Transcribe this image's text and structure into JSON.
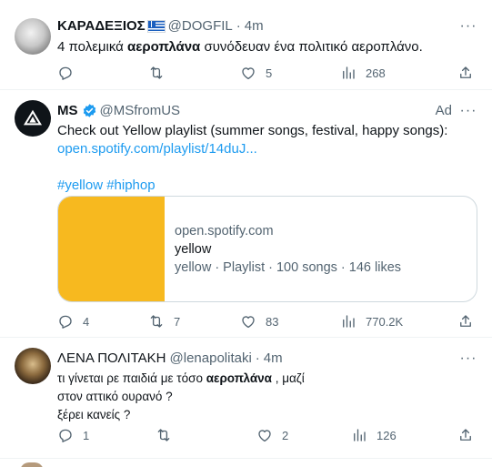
{
  "tweets": [
    {
      "name": "ΚΑΡΑΔΕΞΙΟΣ",
      "handle": "@DOGFIL",
      "sep": "·",
      "time": "4m",
      "text_before": "4 πολεμικά ",
      "text_bold": "αεροπλάνα",
      "text_after": " συνόδευαν ένα πολιτικό αεροπλάνο.",
      "replies": "",
      "retweets": "",
      "likes": "5",
      "views": "268"
    },
    {
      "name": "MS",
      "handle": "@MSfromUS",
      "ad": "Ad",
      "text": "Check out Yellow playlist (summer songs, festival, happy songs):",
      "link": "open.spotify.com/playlist/14duJ...",
      "hashtags": "#yellow #hiphop",
      "card": {
        "domain": "open.spotify.com",
        "title": "yellow",
        "desc": "yellow · Playlist · 100 songs · 146 likes",
        "thumb_color": "#f7b91f"
      },
      "replies": "4",
      "retweets": "7",
      "likes": "83",
      "views": "770.2K"
    },
    {
      "name": "ΛΕΝΑ ΠΟΛΙΤΑΚΗ",
      "handle": "@lenapolitaki",
      "sep": "·",
      "time": "4m",
      "line1_before": "τι γίνεται ρε παιδιά με τόσο ",
      "line1_bold": "αεροπλάνα",
      "line1_after": " , μαζί",
      "line2": "στον αττικό ουρανό ?",
      "line3": "ξέρει κανείς ?",
      "replies": "1",
      "retweets": "",
      "likes": "2",
      "views": "126"
    }
  ],
  "colors": {
    "accent": "#1d9bf0",
    "muted": "#536471",
    "text": "#0f1419",
    "border": "#cfd9de"
  },
  "icons": [
    "reply-icon",
    "retweet-icon",
    "like-icon",
    "views-icon",
    "share-icon",
    "more-icon",
    "verified-badge-icon",
    "greek-flag-icon"
  ]
}
